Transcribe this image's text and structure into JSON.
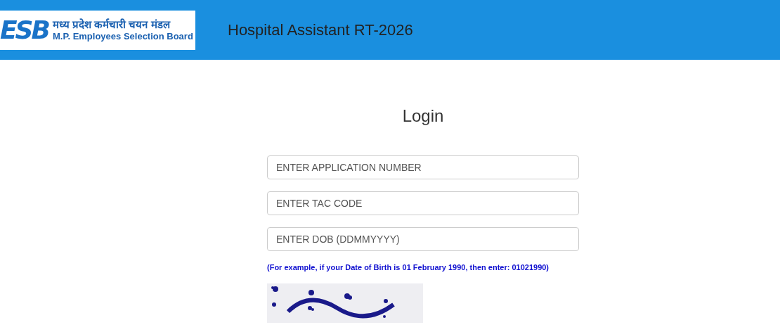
{
  "header": {
    "logo": {
      "mark": "ESB",
      "hindi_name": "मध्य प्रदेश कर्मचारी चयन मंडल",
      "english_name": "M.P. Employees Selection Board"
    },
    "title": "Hospital Assistant RT-2026"
  },
  "form": {
    "heading": "Login",
    "fields": [
      {
        "placeholder": "ENTER APPLICATION NUMBER"
      },
      {
        "placeholder": "ENTER TAC CODE"
      },
      {
        "placeholder": "ENTER DOB (DDMMYYYY)"
      }
    ],
    "hint": "(For example, if your Date of Birth is 01 February 1990, then enter: 01021990)"
  }
}
